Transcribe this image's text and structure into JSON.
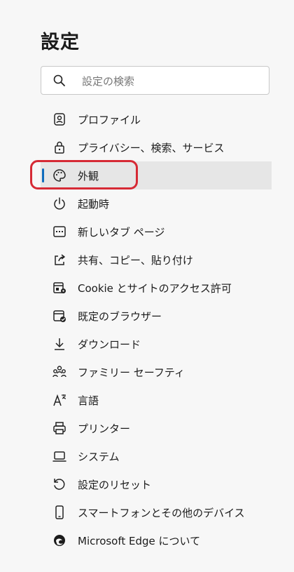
{
  "page_title": "設定",
  "search": {
    "placeholder": "設定の検索"
  },
  "menu": [
    {
      "label": "プロファイル",
      "icon": "profile-icon",
      "active": false
    },
    {
      "label": "プライバシー、検索、サービス",
      "icon": "lock-icon",
      "active": false
    },
    {
      "label": "外観",
      "icon": "palette-icon",
      "active": true
    },
    {
      "label": "起動時",
      "icon": "power-icon",
      "active": false
    },
    {
      "label": "新しいタブ ページ",
      "icon": "new-tab-icon",
      "active": false
    },
    {
      "label": "共有、コピー、貼り付け",
      "icon": "share-icon",
      "active": false
    },
    {
      "label": "Cookie とサイトのアクセス許可",
      "icon": "cookie-permissions-icon",
      "active": false
    },
    {
      "label": "既定のブラウザー",
      "icon": "default-browser-icon",
      "active": false
    },
    {
      "label": "ダウンロード",
      "icon": "download-icon",
      "active": false
    },
    {
      "label": "ファミリー セーフティ",
      "icon": "family-icon",
      "active": false
    },
    {
      "label": "言語",
      "icon": "language-icon",
      "active": false
    },
    {
      "label": "プリンター",
      "icon": "printer-icon",
      "active": false
    },
    {
      "label": "システム",
      "icon": "laptop-icon",
      "active": false
    },
    {
      "label": "設定のリセット",
      "icon": "reset-icon",
      "active": false
    },
    {
      "label": "スマートフォンとその他のデバイス",
      "icon": "phone-icon",
      "active": false
    },
    {
      "label": "Microsoft Edge について",
      "icon": "edge-logo-icon",
      "active": false
    }
  ],
  "colors": {
    "accent": "#0f6cbd",
    "highlight": "#d62a35",
    "background": "#f7f7f7"
  }
}
